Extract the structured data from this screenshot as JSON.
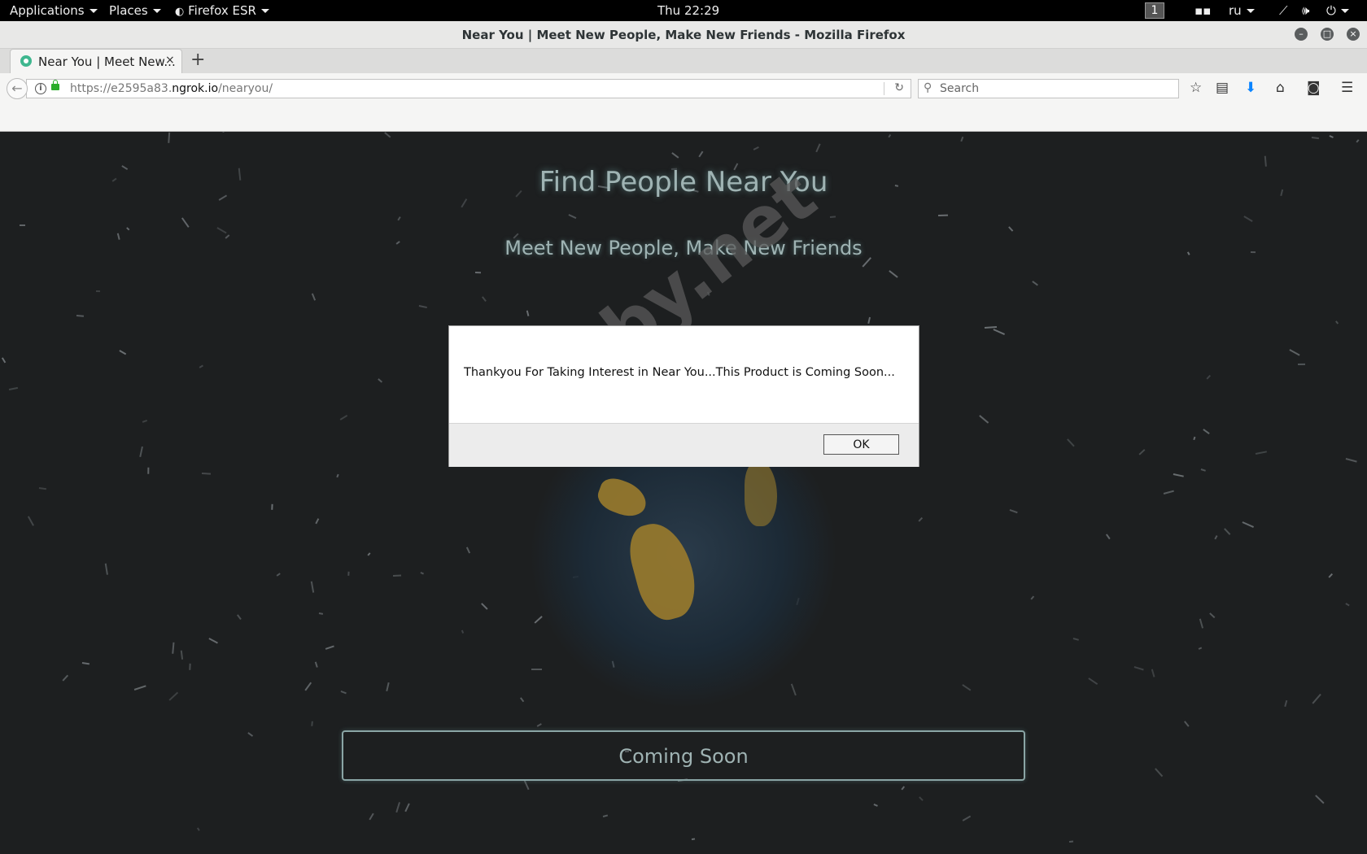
{
  "topbar": {
    "applications": "Applications",
    "places": "Places",
    "firefox": "Firefox ESR",
    "clock": "Thu 22:29",
    "workspace": "1",
    "language": "ru"
  },
  "window": {
    "title": "Near You | Meet New People, Make New Friends - Mozilla Firefox"
  },
  "tab": {
    "title": "Near You | Meet New...",
    "close": "×",
    "new_tab": "+"
  },
  "navbar": {
    "url_prefix": "https://e2595a83.",
    "url_domain": "ngrok.io",
    "url_path": "/nearyou/",
    "search_placeholder": "Search"
  },
  "page": {
    "headline": "Find People Near You",
    "subheadline": "Meet New People, Make New Friends",
    "cta_label": "Coming Soon",
    "watermark": "codeby.net"
  },
  "dialog": {
    "message": "Thankyou For Taking Interest in Near You...This Product is Coming Soon...",
    "ok_label": "OK"
  }
}
